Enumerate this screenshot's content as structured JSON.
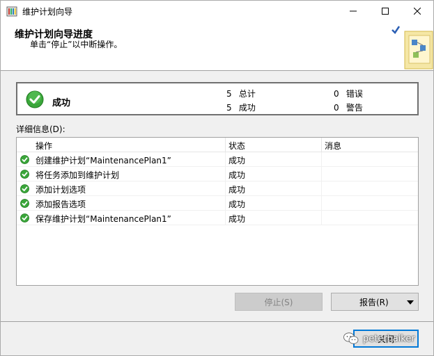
{
  "window": {
    "title": "维护计划向导"
  },
  "header": {
    "title": "维护计划向导进度",
    "subtitle": "单击“停止”以中断操作。"
  },
  "summary": {
    "status": "成功",
    "total_count": "5",
    "total_label": "总计",
    "success_count": "5",
    "success_label": "成功",
    "error_count": "0",
    "error_label": "错误",
    "warning_count": "0",
    "warning_label": "警告"
  },
  "details": {
    "label": "详细信息(D):",
    "columns": [
      "操作",
      "状态",
      "消息"
    ],
    "rows": [
      {
        "operation": "创建维护计划“MaintenancePlan1”",
        "status": "成功",
        "message": ""
      },
      {
        "operation": "将任务添加到维护计划",
        "status": "成功",
        "message": ""
      },
      {
        "operation": "添加计划选项",
        "status": "成功",
        "message": ""
      },
      {
        "operation": "添加报告选项",
        "status": "成功",
        "message": ""
      },
      {
        "operation": "保存维护计划“MaintenancePlan1”",
        "status": "成功",
        "message": ""
      }
    ]
  },
  "buttons": {
    "stop": "停止(S)",
    "report": "报告(R)",
    "close": "关闭"
  },
  "watermark": {
    "text": "peterhaiker"
  },
  "colors": {
    "success_green": "#2e9e2e",
    "focus_blue": "#0078d7"
  }
}
